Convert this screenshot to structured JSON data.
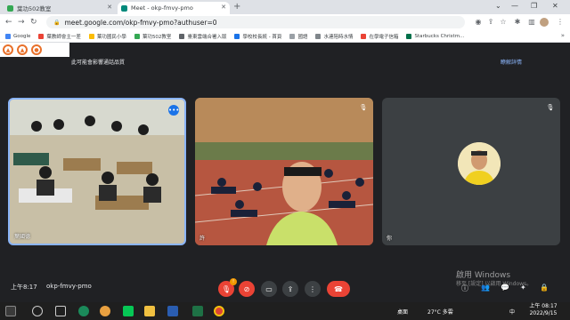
{
  "browser": {
    "tabs": [
      {
        "label": "葉功502教室",
        "active": false
      },
      {
        "label": "Meet - okp-fmvy-pmo",
        "active": true
      }
    ],
    "address": "meet.google.com/okp-fmvy-pmo?authuser=0",
    "bookmarks": [
      {
        "label": "Google"
      },
      {
        "label": "葉教師會主一差"
      },
      {
        "label": "葉功國民小學"
      },
      {
        "label": "葉功502教室"
      },
      {
        "label": "臺東雲端合署入版"
      },
      {
        "label": "學校校長統 - 首頁"
      },
      {
        "label": "國語"
      },
      {
        "label": "水連陪時水情"
      },
      {
        "label": "在學電子信箱"
      },
      {
        "label": "Starbucks Christm..."
      }
    ]
  },
  "meet": {
    "banner_text": "此可能會影響通話品質",
    "banner_link": "瞭解詳情",
    "tiles": [
      {
        "label": "葉國德"
      },
      {
        "label": "許"
      },
      {
        "label": "你"
      }
    ],
    "time": "上午8:17",
    "code": "okp-fmvy-pmo",
    "alert_badge": "!",
    "windows_watermark_title": "啟用 Windows",
    "windows_watermark_sub": "移至 [設定] 以啟用 Windows。"
  },
  "taskbar": {
    "desktop_label": "桌面",
    "weather": "27°C 多雲",
    "lang": "中",
    "clock_time": "上午 08:17",
    "clock_date": "2022/9/15"
  },
  "colors": {
    "accent": "#1a73e8",
    "hangup": "#ea4335",
    "meet_bg": "#202124"
  }
}
